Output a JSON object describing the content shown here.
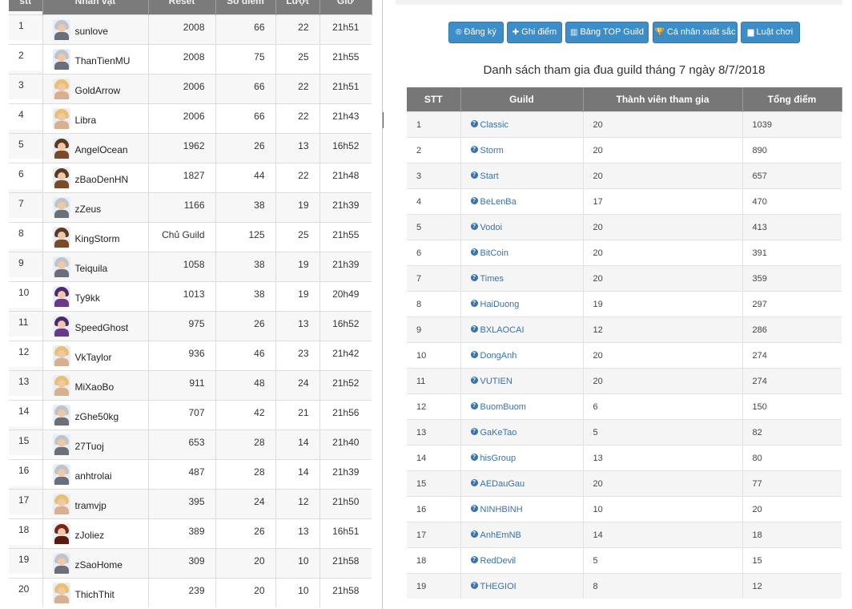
{
  "left_table": {
    "headers": [
      "stt",
      "Nhân vật",
      "Reset",
      "Số điểm",
      "Lượt",
      "Giờ"
    ],
    "rows": [
      {
        "stt": "1",
        "name": "sunlove",
        "reset": "2008",
        "score": "66",
        "turns": "22",
        "time": "21h51",
        "avatar": "male-grey"
      },
      {
        "stt": "2",
        "name": "ThanTienMU",
        "reset": "2008",
        "score": "75",
        "turns": "25",
        "time": "21h55",
        "avatar": "male-grey"
      },
      {
        "stt": "3",
        "name": "GoldArrow",
        "reset": "2006",
        "score": "66",
        "turns": "22",
        "time": "21h51",
        "avatar": "female-blonde"
      },
      {
        "stt": "4",
        "name": "Libra",
        "reset": "2006",
        "score": "66",
        "turns": "22",
        "time": "21h43",
        "avatar": "female-blonde"
      },
      {
        "stt": "5",
        "name": "AngelOcean",
        "reset": "1962",
        "score": "26",
        "turns": "13",
        "time": "16h52",
        "avatar": "male-brown"
      },
      {
        "stt": "6",
        "name": "zBaoDenHN",
        "reset": "1827",
        "score": "44",
        "turns": "22",
        "time": "21h48",
        "avatar": "male-brown"
      },
      {
        "stt": "7",
        "name": "zZeus",
        "reset": "1166",
        "score": "38",
        "turns": "19",
        "time": "21h39",
        "avatar": "male-grey"
      },
      {
        "stt": "8",
        "name": "KingStorm",
        "reset": "Chủ Guild",
        "score": "125",
        "turns": "25",
        "time": "21h55",
        "avatar": "male-brown",
        "highlight": true
      },
      {
        "stt": "9",
        "name": "Teiquila",
        "reset": "1058",
        "score": "38",
        "turns": "19",
        "time": "21h39",
        "avatar": "male-grey"
      },
      {
        "stt": "10",
        "name": "Ty9kk",
        "reset": "1013",
        "score": "38",
        "turns": "19",
        "time": "20h49",
        "avatar": "female-purple"
      },
      {
        "stt": "11",
        "name": "SpeedGhost",
        "reset": "975",
        "score": "26",
        "turns": "13",
        "time": "16h52",
        "avatar": "female-purple"
      },
      {
        "stt": "12",
        "name": "VkTaylor",
        "reset": "936",
        "score": "46",
        "turns": "23",
        "time": "21h42",
        "avatar": "female-blonde"
      },
      {
        "stt": "13",
        "name": "MiXaoBo",
        "reset": "911",
        "score": "48",
        "turns": "24",
        "time": "21h52",
        "avatar": "female-blonde"
      },
      {
        "stt": "14",
        "name": "zGhe50kg",
        "reset": "707",
        "score": "42",
        "turns": "21",
        "time": "21h56",
        "avatar": "male-grey"
      },
      {
        "stt": "15",
        "name": "27Tuoj",
        "reset": "653",
        "score": "28",
        "turns": "14",
        "time": "21h40",
        "avatar": "male-grey"
      },
      {
        "stt": "16",
        "name": "anhtrolai",
        "reset": "487",
        "score": "28",
        "turns": "14",
        "time": "21h39",
        "avatar": "male-grey"
      },
      {
        "stt": "17",
        "name": "tramvjp",
        "reset": "395",
        "score": "24",
        "turns": "12",
        "time": "21h50",
        "avatar": "female-blonde"
      },
      {
        "stt": "18",
        "name": "zJoliez",
        "reset": "389",
        "score": "26",
        "turns": "13",
        "time": "16h51",
        "avatar": "male-red"
      },
      {
        "stt": "19",
        "name": "zSaoHome",
        "reset": "309",
        "score": "20",
        "turns": "10",
        "time": "21h58",
        "avatar": "male-grey"
      },
      {
        "stt": "20",
        "name": "ThichThit",
        "reset": "239",
        "score": "20",
        "turns": "10",
        "time": "21h58",
        "avatar": "female-blonde"
      }
    ]
  },
  "toolbar": {
    "buttons": [
      {
        "label": "Đăng ký",
        "icon": "registered-icon"
      },
      {
        "label": "Ghi điểm",
        "icon": "plus-icon"
      },
      {
        "label": "Bảng TOP Guild",
        "icon": "bar-chart-icon"
      },
      {
        "label": "Cá nhân xuất sắc",
        "icon": "trophy-icon"
      },
      {
        "label": "Luật chơi",
        "icon": "book-icon"
      }
    ]
  },
  "right_table": {
    "title": "Danh sách tham gia đua guild tháng 7 ngày 8/7/2018",
    "headers": [
      "STT",
      "Guild",
      "Thành viên tham gia",
      "Tổng điểm"
    ],
    "rows": [
      {
        "stt": "1",
        "guild": "Classic",
        "members": "20",
        "total": "1039"
      },
      {
        "stt": "2",
        "guild": "Storm",
        "members": "20",
        "total": "890"
      },
      {
        "stt": "3",
        "guild": "Start",
        "members": "20",
        "total": "657"
      },
      {
        "stt": "4",
        "guild": "BeLenBa",
        "members": "17",
        "total": "470"
      },
      {
        "stt": "5",
        "guild": "Vodoi",
        "members": "20",
        "total": "413"
      },
      {
        "stt": "6",
        "guild": "BitCoin",
        "members": "20",
        "total": "391"
      },
      {
        "stt": "7",
        "guild": "Times",
        "members": "20",
        "total": "359"
      },
      {
        "stt": "8",
        "guild": "HaiDuong",
        "members": "19",
        "total": "297"
      },
      {
        "stt": "9",
        "guild": "BXLAOCAI",
        "members": "12",
        "total": "286"
      },
      {
        "stt": "10",
        "guild": "DongAnh",
        "members": "20",
        "total": "274"
      },
      {
        "stt": "11",
        "guild": "VUTIEN",
        "members": "20",
        "total": "274"
      },
      {
        "stt": "12",
        "guild": "BuomBuom",
        "members": "6",
        "total": "150"
      },
      {
        "stt": "13",
        "guild": "GaKeTao",
        "members": "5",
        "total": "82"
      },
      {
        "stt": "14",
        "guild": "hisGroup",
        "members": "13",
        "total": "80"
      },
      {
        "stt": "15",
        "guild": "AEDauGau",
        "members": "20",
        "total": "77"
      },
      {
        "stt": "16",
        "guild": "NINHBINH",
        "members": "10",
        "total": "20"
      },
      {
        "stt": "17",
        "guild": "AnhEmNB",
        "members": "14",
        "total": "18"
      },
      {
        "stt": "18",
        "guild": "RedDevil",
        "members": "5",
        "total": "15"
      },
      {
        "stt": "19",
        "guild": "THEGIOI",
        "members": "8",
        "total": "12"
      }
    ]
  },
  "colors": {
    "button_bg": "#3c8dc8",
    "header_bg": "#777777",
    "guild_link": "#3a72a8",
    "guild_leader": "#e06040"
  }
}
